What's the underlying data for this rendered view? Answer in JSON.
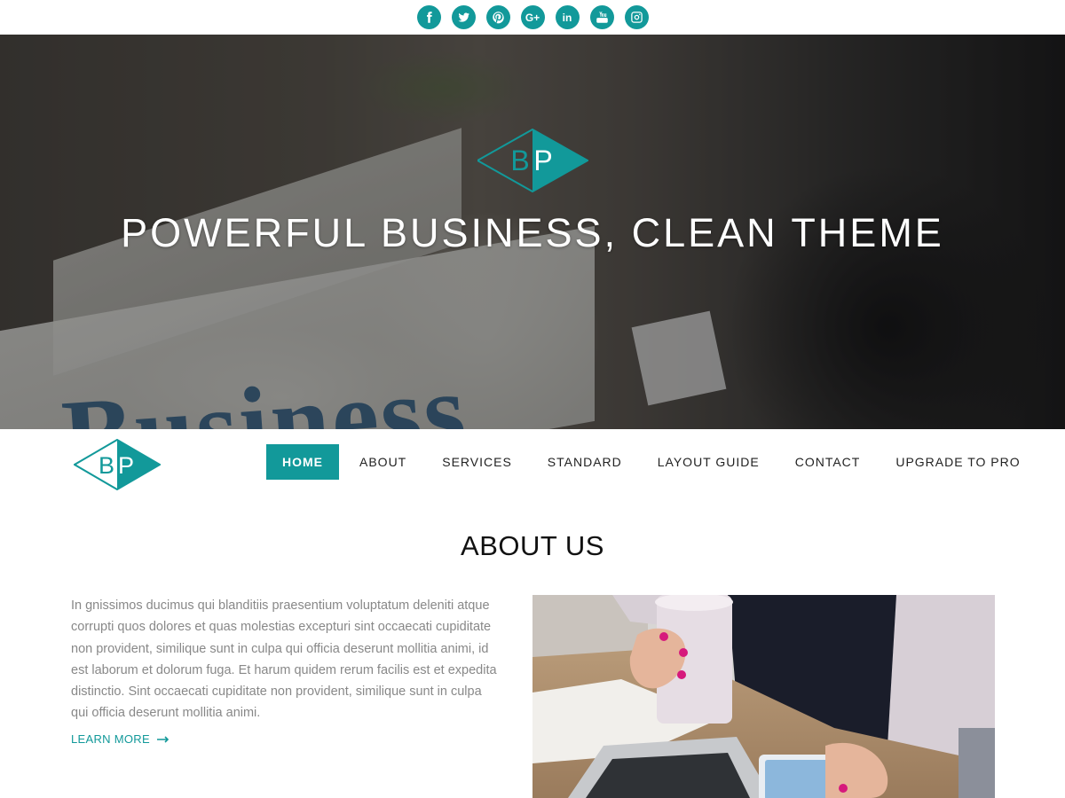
{
  "social": [
    {
      "name": "facebook"
    },
    {
      "name": "twitter"
    },
    {
      "name": "pinterest"
    },
    {
      "name": "google-plus",
      "text": "G+"
    },
    {
      "name": "linkedin",
      "text": "in"
    },
    {
      "name": "youtube"
    },
    {
      "name": "instagram"
    }
  ],
  "brand": {
    "logo_letters_left": "B",
    "logo_letters_right": "P",
    "accent_color": "#12999a"
  },
  "hero": {
    "title": "POWERFUL BUSINESS, CLEAN THEME",
    "background_word": "Business"
  },
  "nav": {
    "items": [
      {
        "label": "HOME",
        "active": true
      },
      {
        "label": "ABOUT"
      },
      {
        "label": "SERVICES"
      },
      {
        "label": "STANDARD"
      },
      {
        "label": "LAYOUT GUIDE"
      },
      {
        "label": "CONTACT"
      },
      {
        "label": "UPGRADE TO PRO"
      }
    ]
  },
  "about": {
    "title": "ABOUT US",
    "paragraph": "In gnissimos ducimus qui blanditiis praesentium voluptatum deleniti atque corrupti quos dolores et quas molestias excepturi sint occaecati cupiditate non provident, similique sunt in culpa qui officia deserunt mollitia animi, id est laborum et dolorum fuga. Et harum quidem rerum facilis est et expedita distinctio. Sint occaecati cupiditate non provident, similique sunt in culpa qui officia deserunt mollitia animi.",
    "learn_more": "LEARN MORE"
  }
}
